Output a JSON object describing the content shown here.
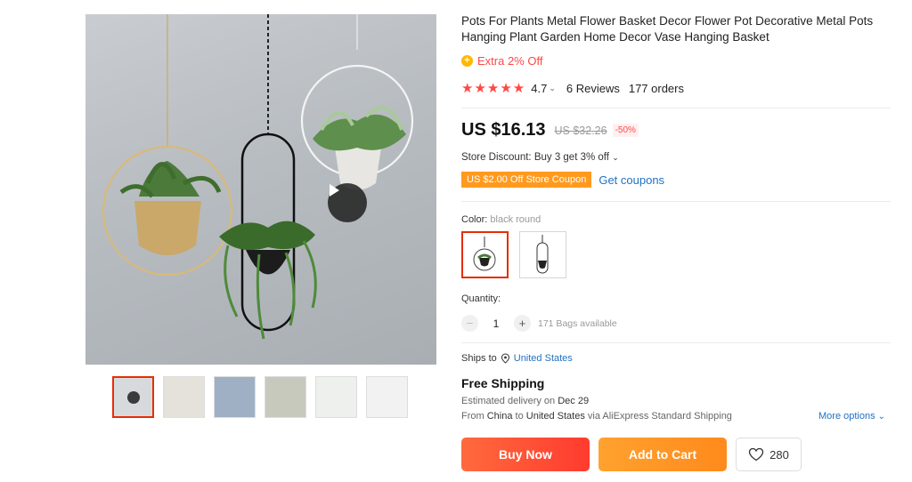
{
  "product": {
    "title": "Pots For Plants Metal Flower Basket Decor Flower Pot Decorative Metal Pots Hanging Plant Garden Home Decor Vase Hanging Basket",
    "extra_off": "Extra 2% Off",
    "rating_stars": "★★★★★",
    "rating_value": "4.7",
    "reviews": "6 Reviews",
    "orders": "177 orders",
    "price": "US $16.13",
    "original_price": "US $32.26",
    "discount": "-50%",
    "store_discount": "Store Discount: Buy 3 get 3% off",
    "coupon": "US $2.00 Off Store Coupon",
    "get_coupons": "Get coupons",
    "color_label": "Color: ",
    "color_value": "black round",
    "quantity_label": "Quantity:",
    "quantity": "1",
    "available": "171 Bags available",
    "ships_to_label": "Ships to",
    "ships_to_country": "United States",
    "shipping_title": "Free Shipping",
    "est_prefix": "Estimated delivery on ",
    "est_date": "Dec 29",
    "from_prefix": "From ",
    "from_country": "China",
    "from_mid": " to ",
    "to_country": "United States",
    "from_suffix": " via AliExpress Standard Shipping",
    "more_options": "More options",
    "buy_now": "Buy Now",
    "add_to_cart": "Add to Cart",
    "wishlist_count": "280"
  },
  "colors": {
    "accent_red": "#ff4747",
    "selected_border": "#e62e04",
    "link_blue": "#2272c4",
    "buy_gradient": "#ff3b2f",
    "cart_gradient": "#ff8a1c"
  },
  "icons": {
    "coin": "coin-icon",
    "location": "location-pin-icon",
    "heart": "heart-icon",
    "play": "play-icon"
  }
}
